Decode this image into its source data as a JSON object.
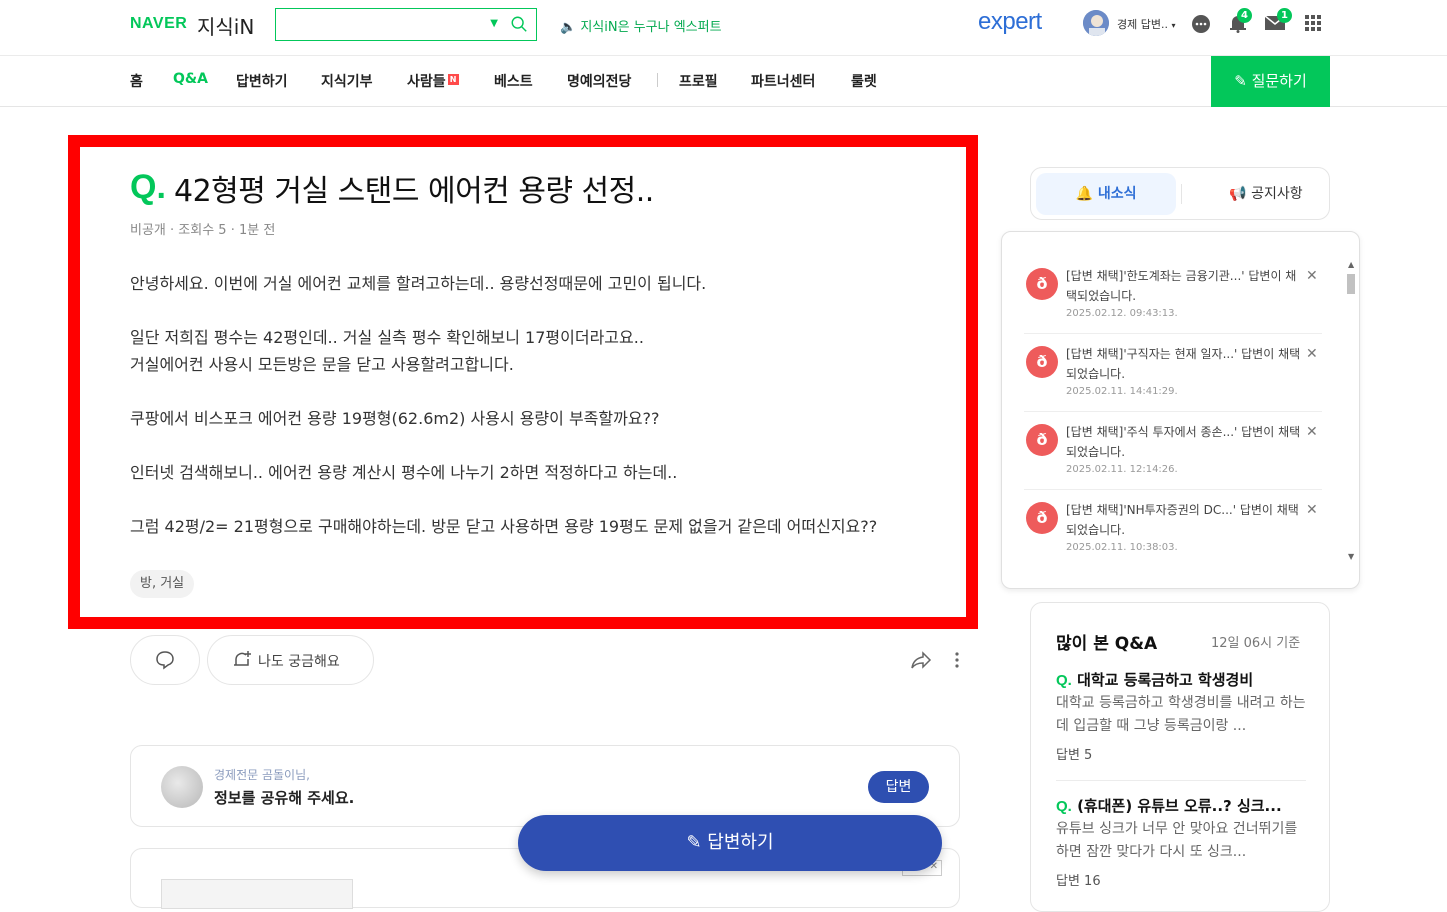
{
  "header": {
    "logo_naver": "NAVER",
    "logo_kin": "지식iN",
    "search_value": "",
    "promo_text": "지식iN은 누구나 엑스퍼트",
    "expert_logo": "expert",
    "user_name": "경제 답변..",
    "badge_bell": "4",
    "badge_mail": "1"
  },
  "nav": {
    "items": [
      "홈",
      "Q&A",
      "답변하기",
      "지식기부",
      "사람들",
      "베스트",
      "명예의전당",
      "프로필",
      "파트너센터",
      "룰렛"
    ],
    "active": "Q&A",
    "new_badge": "N",
    "ask_button": "질문하기"
  },
  "question": {
    "q_mark": "Q.",
    "title": "42형평 거실 스탠드 에어컨 용량 선정..",
    "meta": "비공개 · 조회수 5 · 1분 전",
    "body": [
      "안녕하세요. 이번에 거실 에어컨 교체를 할려고하는데.. 용량선정때문에 고민이 됩니다.",
      "",
      "일단 저희집 평수는 42평인데.. 거실 실측 평수 확인해보니 17평이더라고요..",
      "거실에어컨 사용시 모든방은 문을 닫고 사용할려고합니다.",
      "",
      "쿠팡에서 비스포크 에어컨 용량 19평형(62.6m2) 사용시 용량이 부족할까요??",
      "",
      "인터넷 검색해보니.. 에어컨 용량 계산시 평수에 나누기 2하면 적정하다고 하는데..",
      "",
      "그럼 42평/2= 21평형으로 구매해야하는데. 방문 닫고 사용하면 용량 19평도 문제 없을거 같은데 어떠신지요??"
    ],
    "tag": "방, 거실",
    "curious_label": "나도 궁금해요"
  },
  "answer_prompt": {
    "subtitle": "경제전문 곰돌이님,",
    "message": "정보를 공유해 주세요.",
    "button": "답변"
  },
  "ad_close": "✕",
  "float_button": "답변하기",
  "sidebar": {
    "tab_active": "내소식",
    "tab_other": "공지사항",
    "notifications": [
      {
        "text": "[답변 채택]'한도계좌는 금융기관...' 답변이 채택되었습니다.",
        "time": "2025.02.12. 09:43:13."
      },
      {
        "text": "[답변 채택]'구직자는 현재 일자...' 답변이 채택되었습니다.",
        "time": "2025.02.11. 14:41:29."
      },
      {
        "text": "[답변 채택]'주식 투자에서 종손...' 답변이 채택되었습니다.",
        "time": "2025.02.11. 12:14:26."
      },
      {
        "text": "[답변 채택]'NH투자증권의 DC...' 답변이 채택되었습니다.",
        "time": "2025.02.11. 10:38:03."
      }
    ],
    "popular": {
      "title": "많이 본 Q&A",
      "time": "12일 06시 기준",
      "items": [
        {
          "q": "Q.",
          "title": "대학교 등록금하고 학생경비",
          "desc": "대학교 등록금하고 학생경비를 내려고 하는데 입금할 때 그냥 등록금이랑 ...",
          "count": "답변 5"
        },
        {
          "q": "Q.",
          "title": "(휴대폰) 유튜브 오류..? 싱크...",
          "desc": "유튜브 싱크가 너무 안 맞아요 건너뛰기를 하면 잠깐 맞다가 다시 또 싱크...",
          "count": "답변 16"
        }
      ]
    }
  },
  "colors": {
    "brand": "#03c75a",
    "accent_blue": "#2f4fb2",
    "highlight": "#ff0000"
  }
}
